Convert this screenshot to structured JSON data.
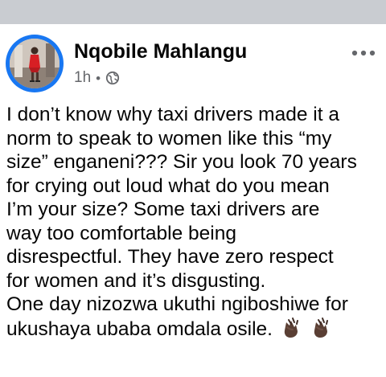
{
  "post": {
    "author_name": "Nqobile Mahlangu",
    "time": "1h",
    "separator": "•",
    "audience_icon": "globe-icon",
    "more_icon": "more-options-icon",
    "text_lines": [
      "I don’t know why taxi drivers made it a",
      "norm to speak to women like this “my",
      "size” enganeni??? Sir you look 70 years",
      "for crying out loud what do you mean",
      "I’m your size? Some taxi drivers are",
      "way too comfortable being",
      "disrespectful. They have zero respect",
      "for women and it’s disgusting.",
      "One day nizozwa ukuthi ngiboshiwe for",
      "ukushaya ubaba omdala osile."
    ],
    "emojis": [
      "👏🏿",
      "👏🏿"
    ]
  },
  "colors": {
    "top_bar": "#c9ccd1",
    "avatar_ring": "#1877f2",
    "name_text": "#050505",
    "meta_text": "#65676b",
    "body_text": "#050505"
  }
}
